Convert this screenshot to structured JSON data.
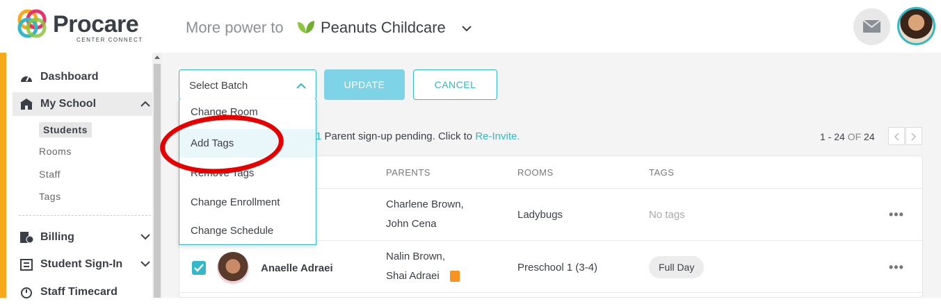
{
  "header": {
    "brand": "Procare",
    "brand_sub": "CENTER CONNECT",
    "tagline": "More power to",
    "school": "Peanuts Childcare"
  },
  "sidebar": {
    "items": [
      {
        "label": "Dashboard",
        "icon": "dashboard-icon"
      },
      {
        "label": "My School",
        "icon": "school-icon",
        "expanded": true
      },
      {
        "label": "Billing",
        "icon": "billing-icon"
      },
      {
        "label": "Student Sign-In",
        "icon": "sign-in-icon"
      },
      {
        "label": "Staff Timecard",
        "icon": "timecard-icon"
      }
    ],
    "sub_items": [
      "Students",
      "Rooms",
      "Staff",
      "Tags"
    ],
    "active_sub": "Students"
  },
  "toolbar": {
    "select_label": "Select Batch",
    "update_label": "UPDATE",
    "cancel_label": "CANCEL"
  },
  "dropdown": {
    "items": [
      "Change Room",
      "Add Tags",
      "Remove Tags",
      "Change Enrollment",
      "Change Schedule"
    ],
    "highlighted": "Add Tags"
  },
  "notice": {
    "count": "1",
    "text": " Parent sign-up pending. Click to ",
    "link": "Re-Invite."
  },
  "pager": {
    "range": "1 - 24",
    "of": "OF",
    "total": "24"
  },
  "table": {
    "headers": [
      "PARENTS",
      "ROOMS",
      "TAGS"
    ],
    "rows": [
      {
        "name": "",
        "parents": [
          "Charlene Brown,",
          "John Cena"
        ],
        "room": "Ladybugs",
        "tags": "No tags",
        "checked": false
      },
      {
        "name": "Anaelle Adraei",
        "parents": [
          "Nalin Brown,",
          "Shai Adraei"
        ],
        "room": "Preschool 1 (3-4)",
        "tags": "Full Day",
        "checked": true
      }
    ],
    "more": "•••"
  },
  "colors": {
    "accent": "#33b8c9",
    "sidebar_stripe": "#f7a81b",
    "annotation": "#e60000"
  }
}
